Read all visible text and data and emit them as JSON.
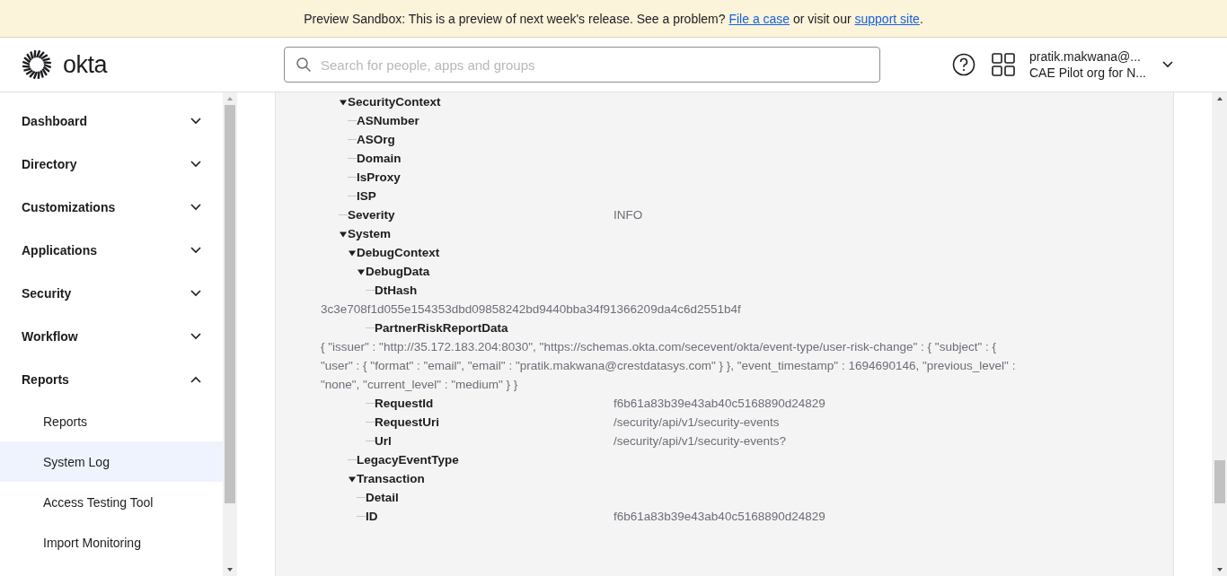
{
  "banner": {
    "parts": [
      {
        "kind": "text",
        "text": "Preview Sandbox: This is a preview of next week's release. See a problem? "
      },
      {
        "kind": "link",
        "text": "File a case"
      },
      {
        "kind": "text",
        "text": " or visit our "
      },
      {
        "kind": "link",
        "text": "support site"
      },
      {
        "kind": "text",
        "text": "."
      }
    ]
  },
  "header": {
    "logo": "okta",
    "search": {
      "placeholder": "Search for people, apps and groups"
    },
    "user": {
      "name": "pratik.makwana@...",
      "org": "CAE Pilot org for N..."
    }
  },
  "sidebar": {
    "items": [
      {
        "label": "Dashboard",
        "expanded": false
      },
      {
        "label": "Directory",
        "expanded": false
      },
      {
        "label": "Customizations",
        "expanded": false
      },
      {
        "label": "Applications",
        "expanded": false
      },
      {
        "label": "Security",
        "expanded": false
      },
      {
        "label": "Workflow",
        "expanded": false
      },
      {
        "label": "Reports",
        "expanded": true,
        "children": [
          {
            "label": "Reports",
            "selected": false
          },
          {
            "label": "System Log",
            "selected": true
          },
          {
            "label": "Access Testing Tool",
            "selected": false
          },
          {
            "label": "Import Monitoring",
            "selected": false
          }
        ]
      }
    ]
  },
  "tree": [
    {
      "label": "SecurityContext",
      "expanded": true,
      "children": [
        {
          "label": "ASNumber"
        },
        {
          "label": "ASOrg"
        },
        {
          "label": "Domain"
        },
        {
          "label": "IsProxy"
        },
        {
          "label": "ISP"
        }
      ]
    },
    {
      "label": "Severity",
      "value": "INFO"
    },
    {
      "label": "System",
      "expanded": true,
      "children": [
        {
          "label": "DebugContext",
          "expanded": true,
          "children": [
            {
              "label": "DebugData",
              "expanded": true,
              "children": [
                {
                  "label": "DtHash",
                  "kind": "long",
                  "value": "3c3e708f1d055e154353dbd09858242bd9440bba34f91366209da4c6d2551b4f"
                },
                {
                  "label": "PartnerRiskReportData",
                  "kind": "long",
                  "value": "{ \"issuer\" : \"http://35.172.183.204:8030\", \"https://schemas.okta.com/secevent/okta/event-type/user-risk-change\" : { \"subject\" : { \"user\" : { \"format\" : \"email\", \"email\" : \"pratik.makwana@crestdatasys.com\" } }, \"event_timestamp\" : 1694690146, \"previous_level\" : \"none\", \"current_level\" : \"medium\" } }"
                },
                {
                  "label": "RequestId",
                  "value": "f6b61a83b39e43ab40c5168890d24829"
                },
                {
                  "label": "RequestUri",
                  "value": "/security/api/v1/security-events"
                },
                {
                  "label": "Url",
                  "value": "/security/api/v1/security-events?"
                }
              ]
            }
          ]
        },
        {
          "label": "LegacyEventType"
        },
        {
          "label": "Transaction",
          "expanded": true,
          "children": [
            {
              "label": "Detail"
            },
            {
              "label": "ID",
              "value": "f6b61a83b39e43ab40c5168890d24829"
            }
          ]
        }
      ]
    }
  ]
}
